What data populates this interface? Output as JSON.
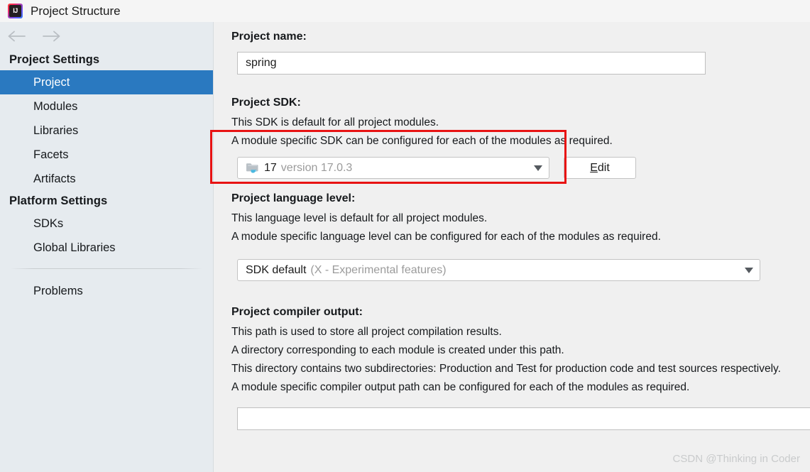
{
  "window": {
    "title": "Project Structure",
    "app_icon": "intellij-idea-icon",
    "background": "#f0f0f0"
  },
  "nav": {
    "back_icon": "arrow-left-icon",
    "forward_icon": "arrow-right-icon"
  },
  "sidebar": {
    "background": "#e6ebef",
    "selected_color": "#2a79c0",
    "groups": [
      {
        "header": "Project Settings",
        "items": [
          {
            "label": "Project",
            "selected": true
          },
          {
            "label": "Modules",
            "selected": false
          },
          {
            "label": "Libraries",
            "selected": false
          },
          {
            "label": "Facets",
            "selected": false
          },
          {
            "label": "Artifacts",
            "selected": false
          }
        ]
      },
      {
        "header": "Platform Settings",
        "items": [
          {
            "label": "SDKs",
            "selected": false
          },
          {
            "label": "Global Libraries",
            "selected": false
          }
        ]
      }
    ],
    "footer_items": [
      {
        "label": "Problems"
      }
    ]
  },
  "main": {
    "project_name": {
      "label": "Project name:",
      "value": "spring",
      "placeholder": ""
    },
    "project_sdk": {
      "label": "Project SDK:",
      "description_lines": [
        "This SDK is default for all project modules.",
        "A module specific SDK can be configured for each of the modules as required."
      ],
      "icon": "java-sdk-folder-icon",
      "value": "17",
      "value_detail": "version 17.0.3",
      "dropdown_icon": "chevron-down-icon",
      "edit_button": {
        "label": "Edit",
        "mnemonic": "E",
        "rest": "dit"
      }
    },
    "project_language_level": {
      "label": "Project language level:",
      "description_lines": [
        "This language level is default for all project modules.",
        "A module specific language level can be configured for each of the modules as required."
      ],
      "value": "SDK default",
      "value_detail": "(X - Experimental features)",
      "dropdown_icon": "chevron-down-icon"
    },
    "project_compiler_output": {
      "label": "Project compiler output:",
      "description_lines": [
        "This path is used to store all project compilation results.",
        "A directory corresponding to each module is created under this path.",
        "This directory contains two subdirectories: Production and Test for production code and test sources respectively.",
        "A module specific compiler output path can be configured for each of the modules as required."
      ],
      "value": "",
      "placeholder": ""
    }
  },
  "annotation": {
    "highlight_color": "#e81313"
  },
  "watermark": {
    "text": "CSDN @Thinking in Coder"
  }
}
